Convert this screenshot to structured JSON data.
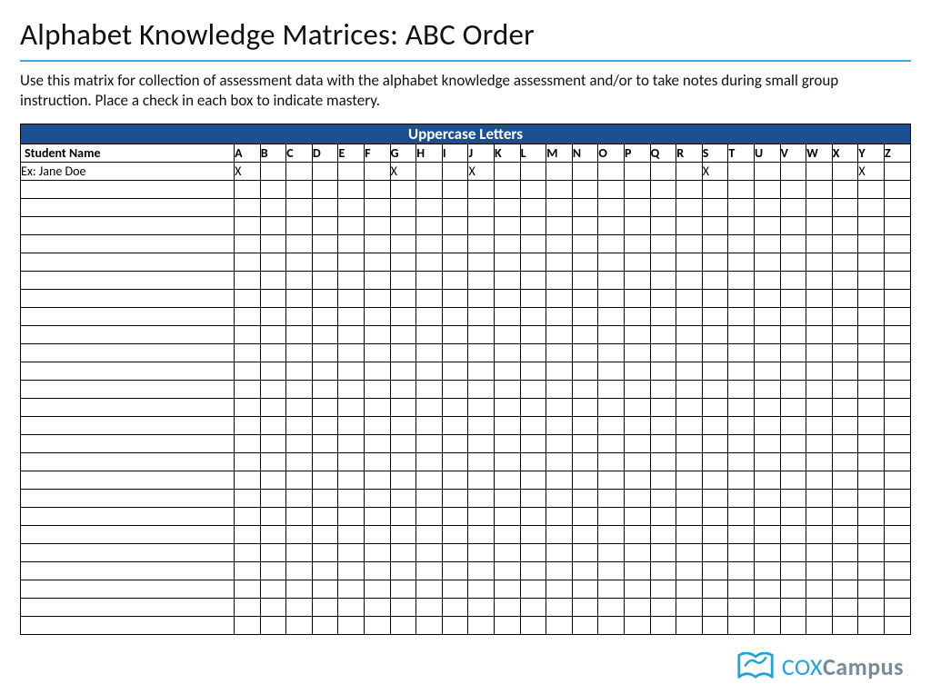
{
  "title": "Alphabet Knowledge Matrices: ABC Order",
  "instructions": "Use this matrix for collection of assessment data with the alphabet knowledge assessment and/or to take notes during small group instruction. Place a check in each box to indicate mastery.",
  "table": {
    "banner": "Uppercase Letters",
    "name_header": "Student Name",
    "columns": [
      "A",
      "B",
      "C",
      "D",
      "E",
      "F",
      "G",
      "H",
      "I",
      "J",
      "K",
      "L",
      "M",
      "N",
      "O",
      "P",
      "Q",
      "R",
      "S",
      "T",
      "U",
      "V",
      "W",
      "X",
      "Y",
      "Z"
    ],
    "example_row": {
      "name": "Ex: Jane Doe",
      "marks": {
        "A": "X",
        "G": "X",
        "J": "X",
        "S": "X",
        "Y": "X"
      }
    },
    "blank_row_count": 25
  },
  "logo": {
    "text_cox": "COX",
    "text_campus": "Campus"
  },
  "colors": {
    "banner_bg": "#1b4f92",
    "rule": "#39a7e0",
    "logo_blue": "#1fa3d8",
    "logo_gray": "#7c8a93"
  }
}
